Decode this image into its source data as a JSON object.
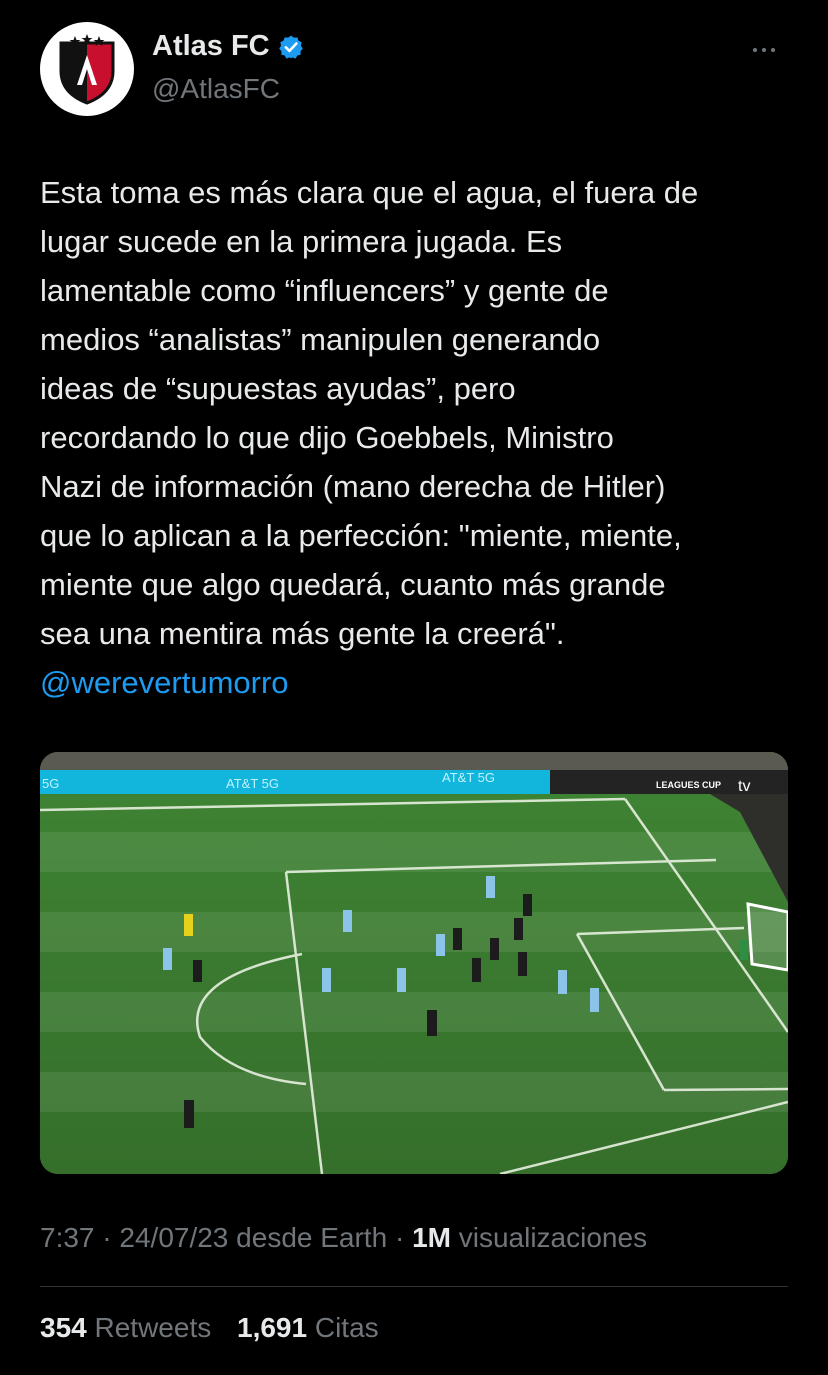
{
  "author": {
    "display_name": "Atlas FC",
    "handle": "@AtlasFC",
    "verified_icon": "verified-badge-icon",
    "avatar_icon": "atlas-crest-icon"
  },
  "tweet": {
    "text": "Esta toma es más clara que el agua, el fuera de\nlugar sucede en la primera jugada. Es\nlamentable como “influencers” y gente de\nmedios “analistas” manipulen generando\nideas de “supuestas ayudas”, pero\nrecordando lo que dijo Goebbels, Ministro\nNazi de información (mano derecha de Hitler)\nque lo aplican a la perfección: \"miente, miente,\nmiente que algo quedará, cuanto más grande\nsea una mentira más gente la creerá\".",
    "mention": "@werevertumorro"
  },
  "media": {
    "banner_texts": [
      "5G",
      "AT&T 5G",
      "AT&T 5G"
    ],
    "broadcast_logo": "LEAGUES CUP",
    "broadcast_tv": "tv"
  },
  "meta": {
    "time": "7:37",
    "sep1": " · ",
    "date": "24/07/23",
    "source": " desde Earth",
    "sep2": " · ",
    "views_count": "1M",
    "views_label": " visualizaciones"
  },
  "stats": {
    "retweets_count": "354",
    "retweets_label": "Retweets",
    "quotes_count": "1,691",
    "quotes_label": "Citas"
  },
  "colors": {
    "link": "#1d9bf0",
    "muted": "#71767b",
    "text": "#e7e9ea",
    "pitch": "#3b7a32"
  }
}
